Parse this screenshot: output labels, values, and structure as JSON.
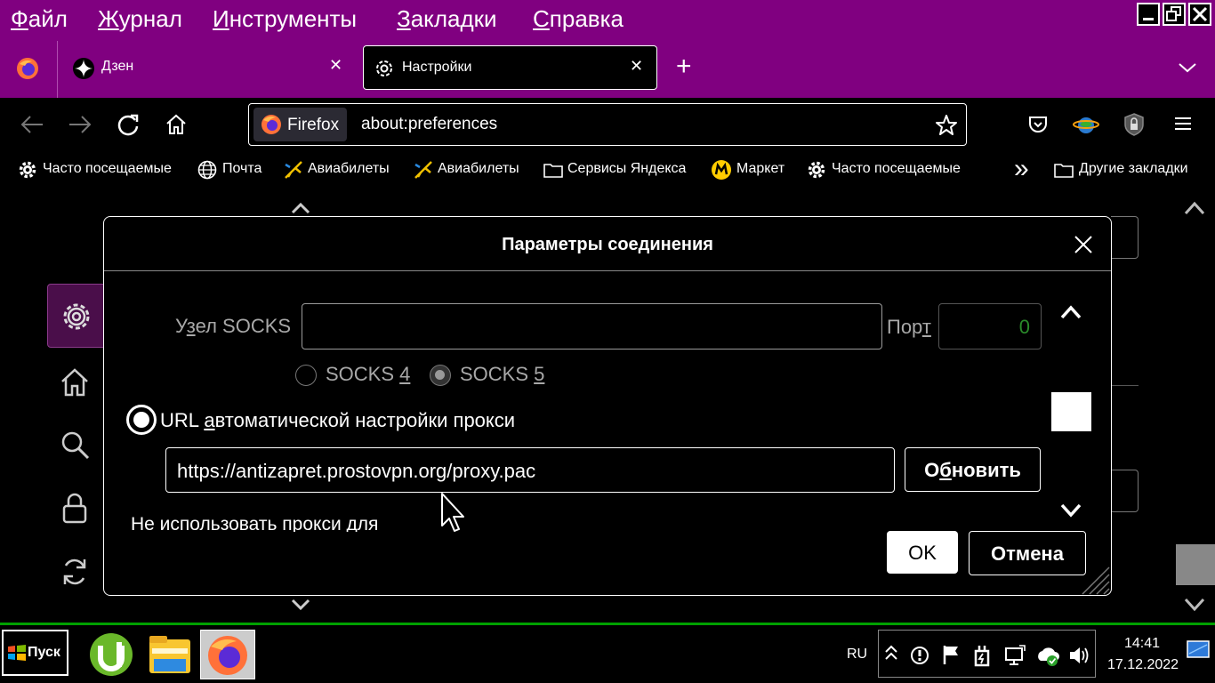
{
  "menu": {
    "items": [
      {
        "first": "Ф",
        "rest": "айл"
      },
      {
        "first": "Ж",
        "rest": "урнал"
      },
      {
        "first": "И",
        "rest": "нструменты"
      },
      {
        "first": "З",
        "rest": "акладки"
      },
      {
        "first": "С",
        "rest": "правка"
      }
    ]
  },
  "tabs": [
    {
      "label": "Дзен",
      "close": "✕"
    },
    {
      "label": "Настройки",
      "close": "✕"
    }
  ],
  "new_tab": "+",
  "urlbar": {
    "identity": "Firefox",
    "url": "about:preferences"
  },
  "bookmarks": [
    "Часто посещаемые",
    "Почта",
    "Авиабилеты",
    "Авиабилеты",
    "Сервисы Яндекса",
    "Маркет",
    "Часто посещаемые",
    "Другие закладки"
  ],
  "bookmarks_overflow": "»",
  "dialog": {
    "title": "Параметры соединения",
    "socks_label_a": "У",
    "socks_label_u": "з",
    "socks_label_b": "ел SOCKS",
    "socks_host_value": "",
    "port_label_a": "Пор",
    "port_label_u": "т",
    "port_value": "0",
    "socks4_a": "SOCKS ",
    "socks4_u": "4",
    "socks5_a": "SOCKS ",
    "socks5_u": "5",
    "auto_label_a": "URL ",
    "auto_label_u": "а",
    "auto_label_b": "втоматической настройки прокси",
    "auto_url": "https://antizapret.prostovpn.org/proxy.pac",
    "reload_a": "О",
    "reload_u": "б",
    "reload_b": "новить",
    "no_proxy_label": "Не использовать прокси для",
    "ok": "OK",
    "cancel": "Отмена"
  },
  "taskbar": {
    "start": "Пуск",
    "lang": "RU",
    "time": "14:41",
    "date": "17.12.2022"
  },
  "colors": {
    "menubar": "#800080",
    "taskbar_border": "#00a000",
    "port_value": "#2a8a2a"
  }
}
